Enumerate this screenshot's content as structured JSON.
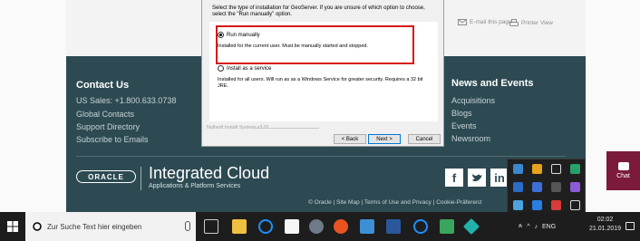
{
  "page": {
    "toolbar": {
      "email": "E-mail this page",
      "print": "Printer View"
    },
    "contact": {
      "title": "Contact Us",
      "items": [
        "US Sales: +1.800.633.0738",
        "Global Contacts",
        "Support Directory",
        "Subscribe to Emails"
      ]
    },
    "news": {
      "title": "News and Events",
      "items": [
        "Acquisitions",
        "Blogs",
        "Events",
        "Newsroom"
      ]
    },
    "brand": {
      "logo": "ORACLE",
      "title": "Integrated Cloud",
      "subtitle": "Applications & Platform Services"
    },
    "footer_links": "© Oracle | Site Map | Terms of Use and Privacy | Cookie-Präferenz"
  },
  "installer": {
    "description": "Select the type of installation for GeoServer. If you are unsure of which option to choose, select the \"Run manually\" option.",
    "option1": {
      "label": "Run manually",
      "desc": "Installed for the current user. Must be manually started and stopped.",
      "selected": true
    },
    "option2": {
      "label": "Install as a service",
      "desc": "Installed for all users. Will run as as a Windows Service for greater security. Requires a 32 bit JRE.",
      "selected": false
    },
    "branding": "Nullsoft Install System v3.01",
    "buttons": {
      "back": "< Back",
      "next": "Next >",
      "cancel": "Cancel"
    }
  },
  "chat": {
    "label": "Chat"
  },
  "taskbar": {
    "search_placeholder": "Zur Suche Text hier eingeben",
    "lang": "ENG",
    "time": "02:02",
    "date": "21.01.2019"
  },
  "colors": {
    "footer_bg": "#2d4a52",
    "highlight": "#d81818",
    "chat_bg": "#7b1a3a",
    "taskbar_bg": "#1d1d1d"
  }
}
